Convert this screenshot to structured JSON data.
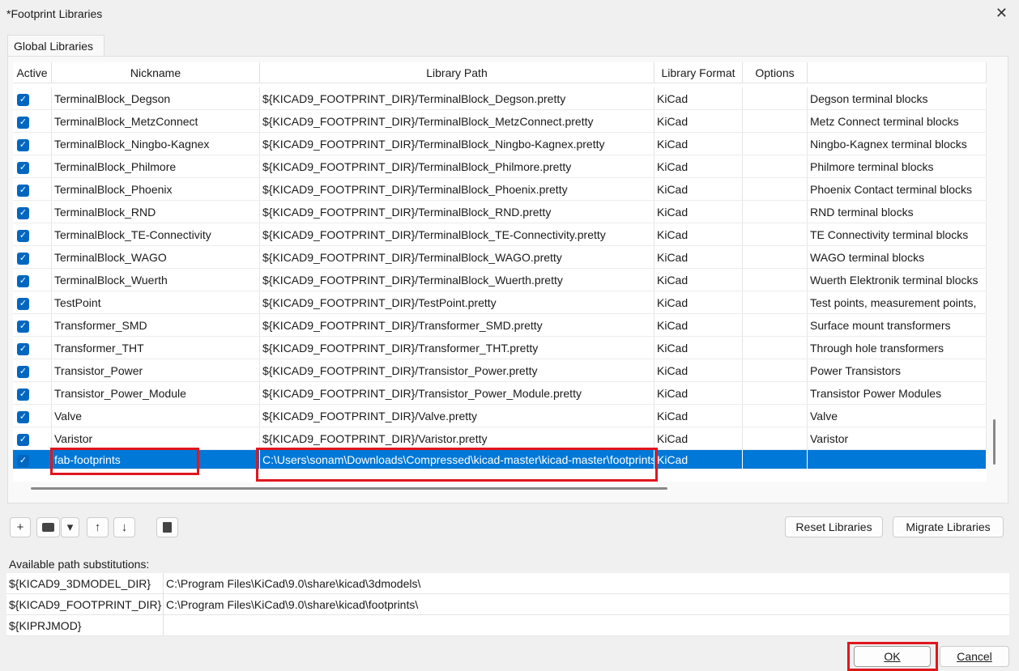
{
  "window": {
    "title": "*Footprint Libraries",
    "close": "✕"
  },
  "tab": "Global Libraries",
  "columns": [
    "Active",
    "Nickname",
    "Library Path",
    "Library Format",
    "Options",
    ""
  ],
  "rows": [
    {
      "nick": "TerminalBlock_Degson",
      "path": "${KICAD9_FOOTPRINT_DIR}/TerminalBlock_Degson.pretty",
      "format": "KiCad",
      "options": "",
      "desc": "Degson terminal blocks"
    },
    {
      "nick": "TerminalBlock_MetzConnect",
      "path": "${KICAD9_FOOTPRINT_DIR}/TerminalBlock_MetzConnect.pretty",
      "format": "KiCad",
      "options": "",
      "desc": "Metz Connect terminal blocks"
    },
    {
      "nick": "TerminalBlock_Ningbo-Kagnex",
      "path": "${KICAD9_FOOTPRINT_DIR}/TerminalBlock_Ningbo-Kagnex.pretty",
      "format": "KiCad",
      "options": "",
      "desc": "Ningbo-Kagnex terminal blocks"
    },
    {
      "nick": "TerminalBlock_Philmore",
      "path": "${KICAD9_FOOTPRINT_DIR}/TerminalBlock_Philmore.pretty",
      "format": "KiCad",
      "options": "",
      "desc": "Philmore terminal blocks"
    },
    {
      "nick": "TerminalBlock_Phoenix",
      "path": "${KICAD9_FOOTPRINT_DIR}/TerminalBlock_Phoenix.pretty",
      "format": "KiCad",
      "options": "",
      "desc": "Phoenix Contact terminal blocks"
    },
    {
      "nick": "TerminalBlock_RND",
      "path": "${KICAD9_FOOTPRINT_DIR}/TerminalBlock_RND.pretty",
      "format": "KiCad",
      "options": "",
      "desc": "RND terminal blocks"
    },
    {
      "nick": "TerminalBlock_TE-Connectivity",
      "path": "${KICAD9_FOOTPRINT_DIR}/TerminalBlock_TE-Connectivity.pretty",
      "format": "KiCad",
      "options": "",
      "desc": "TE Connectivity terminal blocks"
    },
    {
      "nick": "TerminalBlock_WAGO",
      "path": "${KICAD9_FOOTPRINT_DIR}/TerminalBlock_WAGO.pretty",
      "format": "KiCad",
      "options": "",
      "desc": "WAGO terminal blocks"
    },
    {
      "nick": "TerminalBlock_Wuerth",
      "path": "${KICAD9_FOOTPRINT_DIR}/TerminalBlock_Wuerth.pretty",
      "format": "KiCad",
      "options": "",
      "desc": "Wuerth Elektronik terminal blocks"
    },
    {
      "nick": "TestPoint",
      "path": "${KICAD9_FOOTPRINT_DIR}/TestPoint.pretty",
      "format": "KiCad",
      "options": "",
      "desc": "Test points, measurement points,"
    },
    {
      "nick": "Transformer_SMD",
      "path": "${KICAD9_FOOTPRINT_DIR}/Transformer_SMD.pretty",
      "format": "KiCad",
      "options": "",
      "desc": "Surface mount transformers"
    },
    {
      "nick": "Transformer_THT",
      "path": "${KICAD9_FOOTPRINT_DIR}/Transformer_THT.pretty",
      "format": "KiCad",
      "options": "",
      "desc": "Through hole transformers"
    },
    {
      "nick": "Transistor_Power",
      "path": "${KICAD9_FOOTPRINT_DIR}/Transistor_Power.pretty",
      "format": "KiCad",
      "options": "",
      "desc": "Power Transistors"
    },
    {
      "nick": "Transistor_Power_Module",
      "path": "${KICAD9_FOOTPRINT_DIR}/Transistor_Power_Module.pretty",
      "format": "KiCad",
      "options": "",
      "desc": "Transistor Power Modules"
    },
    {
      "nick": "Valve",
      "path": "${KICAD9_FOOTPRINT_DIR}/Valve.pretty",
      "format": "KiCad",
      "options": "",
      "desc": "Valve"
    },
    {
      "nick": "Varistor",
      "path": "${KICAD9_FOOTPRINT_DIR}/Varistor.pretty",
      "format": "KiCad",
      "options": "",
      "desc": "Varistor"
    },
    {
      "nick": "fab-footprints",
      "path": "C:\\Users\\sonam\\Downloads\\Compressed\\kicad-master\\kicad-master\\footprints",
      "format": "KiCad",
      "options": "",
      "desc": "",
      "selected": true
    }
  ],
  "toolbar": {
    "add": "+",
    "folder": "folder",
    "dropdown": "▾",
    "up": "↑",
    "down": "↓",
    "delete": "trash"
  },
  "buttons": {
    "reset": "Reset Libraries",
    "migrate": "Migrate Libraries",
    "ok": "OK",
    "cancel": "Cancel"
  },
  "substitutions": {
    "label": "Available path substitutions:",
    "rows": [
      {
        "key": "${KICAD9_3DMODEL_DIR}",
        "value": "C:\\Program Files\\KiCad\\9.0\\share\\kicad\\3dmodels\\"
      },
      {
        "key": "${KICAD9_FOOTPRINT_DIR}",
        "value": "C:\\Program Files\\KiCad\\9.0\\share\\kicad\\footprints\\"
      },
      {
        "key": "${KIPRJMOD}",
        "value": ""
      }
    ]
  },
  "colors": {
    "selection": "#0078d7",
    "checkbox": "#0067c0",
    "highlight": "#e0161e"
  }
}
